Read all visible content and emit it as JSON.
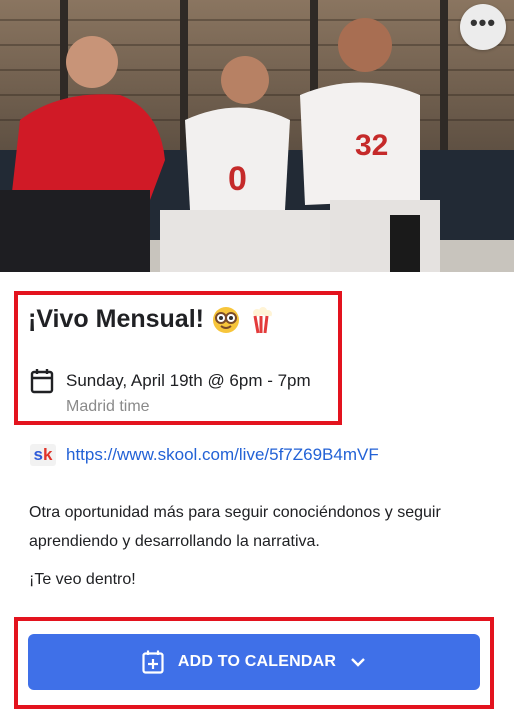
{
  "hero": {
    "more_icon": "more-horizontal-icon",
    "more_label": "•••"
  },
  "event": {
    "title": "¡Vivo Mensual!",
    "title_emojis": [
      "nerd-face-emoji",
      "popcorn-emoji"
    ],
    "date_icon": "calendar-icon",
    "date_text": "Sunday, April 19th @ 6pm - 7pm",
    "timezone": "Madrid time",
    "link_icon": "skool-logo",
    "link_logo_text": "sk",
    "link_url": "https://www.skool.com/live/5f7Z69B4mVF",
    "description": "Otra oportunidad más para seguir conociéndonos y seguir aprendiendo y desarrollando la narrativa.",
    "closing": "¡Te veo dentro!"
  },
  "cta": {
    "label": "ADD TO CALENDAR",
    "icon": "calendar-add-icon",
    "chevron": "chevron-down-icon"
  },
  "colors": {
    "highlight": "#e3131e",
    "accent": "#3f70e8",
    "link": "#2362d6"
  }
}
